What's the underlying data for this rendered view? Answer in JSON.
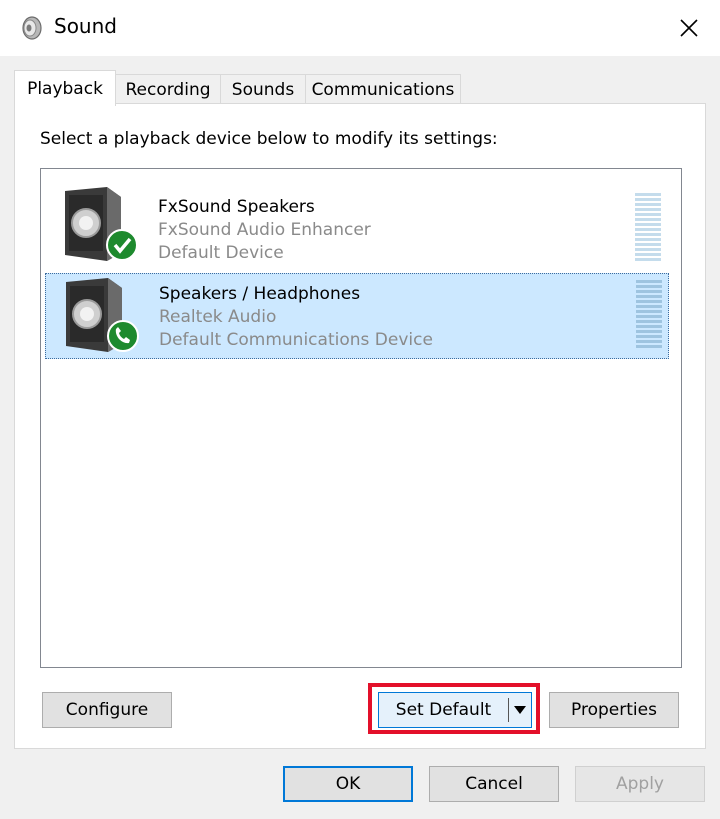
{
  "window": {
    "title": "Sound",
    "icon": "speaker-icon"
  },
  "tabs": [
    {
      "label": "Playback",
      "active": true
    },
    {
      "label": "Recording",
      "active": false
    },
    {
      "label": "Sounds",
      "active": false
    },
    {
      "label": "Communications",
      "active": false
    }
  ],
  "playback": {
    "instruction": "Select a playback device below to modify its settings:",
    "devices": [
      {
        "name": "FxSound Speakers",
        "driver": "FxSound Audio Enhancer",
        "status": "Default Device",
        "badge": "check-badge-icon",
        "selected": false
      },
      {
        "name": "Speakers / Headphones",
        "driver": "Realtek Audio",
        "status": "Default Communications Device",
        "badge": "phone-badge-icon",
        "selected": true
      }
    ],
    "buttons": {
      "configure": "Configure",
      "set_default": "Set Default",
      "properties": "Properties"
    }
  },
  "footer": {
    "ok": "OK",
    "cancel": "Cancel",
    "apply": "Apply"
  },
  "colors": {
    "selection": "#cce8ff",
    "badge_green": "#1e8a2e",
    "highlight_red": "#e3102a",
    "accent": "#0078d7"
  }
}
